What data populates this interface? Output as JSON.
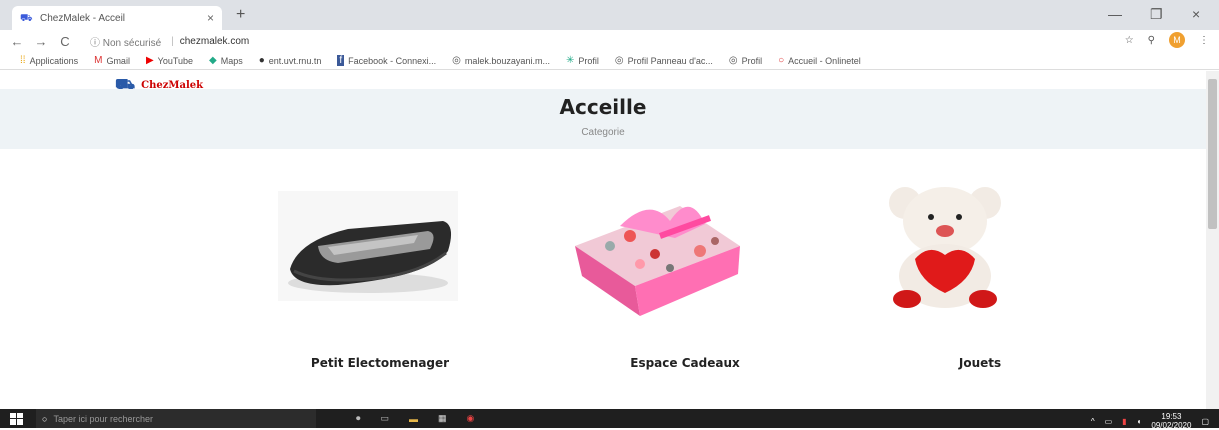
{
  "browser": {
    "tab_title": "ChezMalek - Acceil",
    "tab_close": "×",
    "new_tab": "+",
    "win_min": "—",
    "win_max": "❐",
    "win_close": "×",
    "back": "←",
    "forward": "→",
    "reload": "C",
    "security": "ⓘ Non sécurisé",
    "url": "chezmalek.com",
    "star": "☆",
    "lens": "⚲",
    "avatar": "M",
    "menu": "⋮"
  },
  "bookmarks": [
    {
      "icon": "apps-icon",
      "glyph": "⁞⁞",
      "label": "Applications"
    },
    {
      "icon": "gmail-icon",
      "glyph": "M",
      "label": "Gmail"
    },
    {
      "icon": "youtube-icon",
      "glyph": "▶",
      "label": "YouTube"
    },
    {
      "icon": "maps-icon",
      "glyph": "◆",
      "label": "Maps"
    },
    {
      "icon": "site-icon",
      "glyph": "●",
      "label": "ent.uvt.rnu.tn"
    },
    {
      "icon": "facebook-icon",
      "glyph": "f",
      "label": "Facebook - Connexi..."
    },
    {
      "icon": "globe-icon",
      "glyph": "◎",
      "label": "malek.bouzayani.m..."
    },
    {
      "icon": "star-icon",
      "glyph": "✳",
      "label": "Profil"
    },
    {
      "icon": "globe-icon",
      "glyph": "◎",
      "label": "Profil Panneau d'ac..."
    },
    {
      "icon": "globe-icon",
      "glyph": "◎",
      "label": "Profil"
    },
    {
      "icon": "circle-icon",
      "glyph": "○",
      "label": "Accueil - Onlinetel"
    }
  ],
  "site": {
    "brand": "ChezMalek",
    "title": "Acceille",
    "subtitle": "Categorie"
  },
  "categories": [
    {
      "label": "Petit Electomenager",
      "image": "sandwich-maker"
    },
    {
      "label": "Espace Cadeaux",
      "image": "gift-box"
    },
    {
      "label": "Jouets",
      "image": "teddy-bear"
    }
  ],
  "taskbar": {
    "search_placeholder": "Taper ici pour rechercher",
    "time": "19:53",
    "date": "09/02/2020"
  }
}
